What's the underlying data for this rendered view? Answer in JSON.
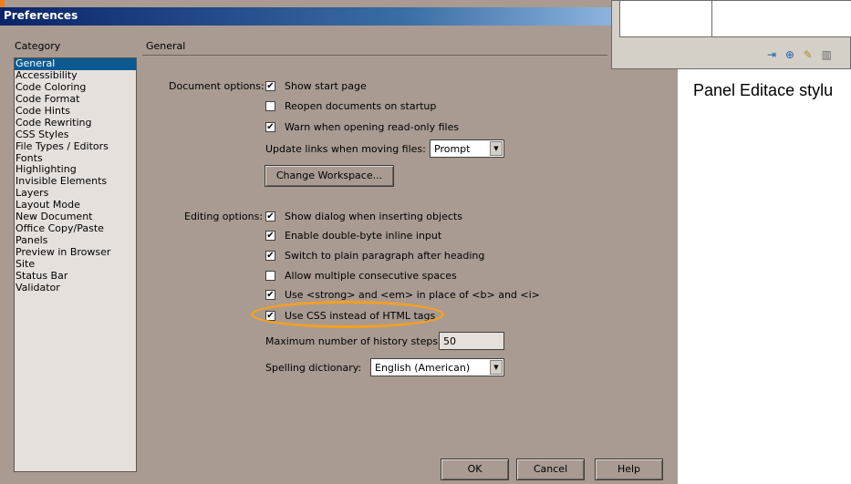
{
  "dialog": {
    "title": "Preferences",
    "category_header": "Category",
    "section_header": "General",
    "categories": [
      "General",
      "Accessibility",
      "Code Coloring",
      "Code Format",
      "Code Hints",
      "Code Rewriting",
      "CSS Styles",
      "File Types / Editors",
      "Fonts",
      "Highlighting",
      "Invisible Elements",
      "Layers",
      "Layout Mode",
      "New Document",
      "Office Copy/Paste",
      "Panels",
      "Preview in Browser",
      "Site",
      "Status Bar",
      "Validator"
    ],
    "selected_category": "General"
  },
  "document_options": {
    "label": "Document options:",
    "show_start_page": {
      "label": "Show start page",
      "checked": true
    },
    "reopen_documents": {
      "label": "Reopen documents on startup",
      "checked": false
    },
    "warn_readonly": {
      "label": "Warn when opening read-only files",
      "checked": true
    },
    "update_links_label": "Update links when moving files:",
    "update_links_value": "Prompt",
    "change_workspace": "Change Workspace..."
  },
  "editing_options": {
    "label": "Editing options:",
    "show_dialog": {
      "label": "Show dialog when inserting objects",
      "checked": true
    },
    "double_byte": {
      "label": "Enable double-byte inline input",
      "checked": true
    },
    "plain_paragraph": {
      "label": "Switch to plain paragraph after heading",
      "checked": true
    },
    "multiple_spaces": {
      "label": "Allow multiple consecutive spaces",
      "checked": false
    },
    "use_strong": {
      "label": "Use <strong> and <em> in place of <b> and <i>",
      "checked": true
    },
    "use_css": {
      "label": "Use CSS instead of HTML tags",
      "checked": true
    },
    "history_label": "Maximum number of history steps:",
    "history_value": "50",
    "spelling_label": "Spelling dictionary:",
    "spelling_value": "English (American)"
  },
  "buttons": {
    "ok": "OK",
    "cancel": "Cancel",
    "help": "Help"
  },
  "check_mark": "✔",
  "panel": {
    "caption": "Panel Editace stylu",
    "icons": [
      "attach-stylesheet-icon",
      "new-style-icon",
      "edit-style-icon",
      "delete-style-icon"
    ]
  },
  "colors": {
    "dialog_bg": "#a99b91",
    "selection": "#0a5a91",
    "highlight": "#f5a023",
    "title_bar": "#0a246a"
  }
}
